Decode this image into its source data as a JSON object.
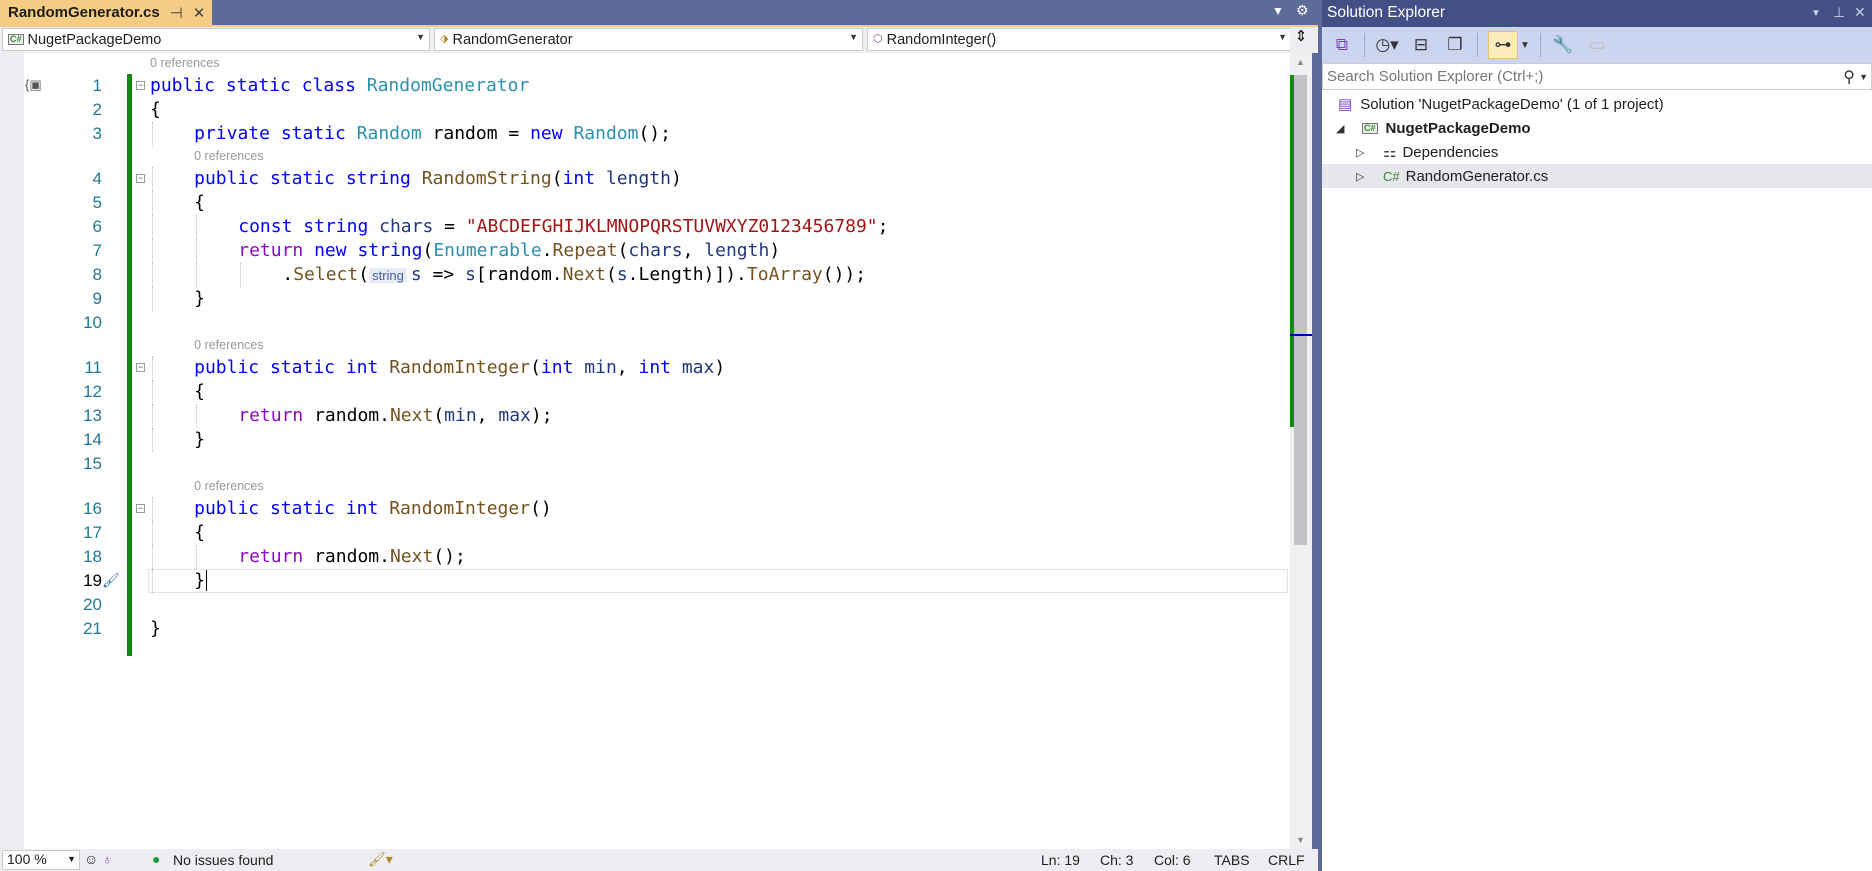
{
  "tab": {
    "title": "RandomGenerator.cs",
    "pin": "⊣",
    "close": "✕"
  },
  "nav": {
    "project": "NugetPackageDemo",
    "class": "RandomGenerator",
    "member": "RandomInteger()"
  },
  "code_rows": [
    {
      "kind": "lens",
      "text": "0 references"
    },
    {
      "kind": "code",
      "num": "1",
      "fold": true,
      "indent": 0,
      "tokens": [
        [
          "kw",
          "public "
        ],
        [
          "kw",
          "static "
        ],
        [
          "kw",
          "class "
        ],
        [
          "ty",
          "RandomGenerator"
        ]
      ]
    },
    {
      "kind": "code",
      "num": "2",
      "indent": 0,
      "tokens": [
        [
          "tx",
          "{"
        ]
      ]
    },
    {
      "kind": "code",
      "num": "3",
      "indent": 1,
      "tokens": [
        [
          "kw",
          "private "
        ],
        [
          "kw",
          "static "
        ],
        [
          "ty",
          "Random "
        ],
        [
          "tx",
          "random = "
        ],
        [
          "kw",
          "new "
        ],
        [
          "ty",
          "Random"
        ],
        [
          "tx",
          "();"
        ]
      ]
    },
    {
      "kind": "lens",
      "text": "0 references"
    },
    {
      "kind": "code",
      "num": "4",
      "fold": true,
      "indent": 1,
      "tokens": [
        [
          "kw",
          "public "
        ],
        [
          "kw",
          "static "
        ],
        [
          "kw",
          "string "
        ],
        [
          "me",
          "RandomString"
        ],
        [
          "tx",
          "("
        ],
        [
          "kw",
          "int "
        ],
        [
          "pa",
          "length"
        ],
        [
          "tx",
          ")"
        ]
      ]
    },
    {
      "kind": "code",
      "num": "5",
      "indent": 1,
      "tokens": [
        [
          "tx",
          "{"
        ]
      ]
    },
    {
      "kind": "code",
      "num": "6",
      "indent": 2,
      "tokens": [
        [
          "kw",
          "const "
        ],
        [
          "kw",
          "string "
        ],
        [
          "pa",
          "chars"
        ],
        [
          "tx",
          " = "
        ],
        [
          "st",
          "\"ABCDEFGHIJKLMNOPQRSTUVWXYZ0123456789\""
        ],
        [
          "tx",
          ";"
        ]
      ]
    },
    {
      "kind": "code",
      "num": "7",
      "indent": 2,
      "tokens": [
        [
          "ct",
          "return "
        ],
        [
          "kw",
          "new "
        ],
        [
          "kw",
          "string"
        ],
        [
          "tx",
          "("
        ],
        [
          "ty",
          "Enumerable"
        ],
        [
          "tx",
          "."
        ],
        [
          "me",
          "Repeat"
        ],
        [
          "tx",
          "("
        ],
        [
          "pa",
          "chars"
        ],
        [
          "tx",
          ", "
        ],
        [
          "pa",
          "length"
        ],
        [
          "tx",
          ")"
        ]
      ]
    },
    {
      "kind": "code",
      "num": "8",
      "indent": 3,
      "tokens": [
        [
          "tx",
          "."
        ],
        [
          "me",
          "Select"
        ],
        [
          "tx",
          "("
        ],
        [
          "hint",
          "string"
        ],
        [
          "pa",
          "s"
        ],
        [
          "tx",
          " => "
        ],
        [
          "pa",
          "s"
        ],
        [
          "tx",
          "["
        ],
        [
          "tx",
          "random."
        ],
        [
          "me",
          "Next"
        ],
        [
          "tx",
          "("
        ],
        [
          "pa",
          "s"
        ],
        [
          "tx",
          ".Length)])."
        ],
        [
          "me",
          "ToArray"
        ],
        [
          "tx",
          "());"
        ]
      ]
    },
    {
      "kind": "code",
      "num": "9",
      "indent": 1,
      "tokens": [
        [
          "tx",
          "}"
        ]
      ]
    },
    {
      "kind": "code",
      "num": "10",
      "indent": 0,
      "tokens": []
    },
    {
      "kind": "lens",
      "text": "0 references"
    },
    {
      "kind": "code",
      "num": "11",
      "fold": true,
      "indent": 1,
      "tokens": [
        [
          "kw",
          "public "
        ],
        [
          "kw",
          "static "
        ],
        [
          "kw",
          "int "
        ],
        [
          "me",
          "RandomInteger"
        ],
        [
          "tx",
          "("
        ],
        [
          "kw",
          "int "
        ],
        [
          "pa",
          "min"
        ],
        [
          "tx",
          ", "
        ],
        [
          "kw",
          "int "
        ],
        [
          "pa",
          "max"
        ],
        [
          "tx",
          ")"
        ]
      ]
    },
    {
      "kind": "code",
      "num": "12",
      "indent": 1,
      "tokens": [
        [
          "tx",
          "{"
        ]
      ]
    },
    {
      "kind": "code",
      "num": "13",
      "indent": 2,
      "tokens": [
        [
          "ct",
          "return "
        ],
        [
          "tx",
          "random."
        ],
        [
          "me",
          "Next"
        ],
        [
          "tx",
          "("
        ],
        [
          "pa",
          "min"
        ],
        [
          "tx",
          ", "
        ],
        [
          "pa",
          "max"
        ],
        [
          "tx",
          ");"
        ]
      ]
    },
    {
      "kind": "code",
      "num": "14",
      "indent": 1,
      "tokens": [
        [
          "tx",
          "}"
        ]
      ]
    },
    {
      "kind": "code",
      "num": "15",
      "indent": 0,
      "tokens": []
    },
    {
      "kind": "lens",
      "text": "0 references"
    },
    {
      "kind": "code",
      "num": "16",
      "fold": true,
      "indent": 1,
      "tokens": [
        [
          "kw",
          "public "
        ],
        [
          "kw",
          "static "
        ],
        [
          "kw",
          "int "
        ],
        [
          "me",
          "RandomInteger"
        ],
        [
          "tx",
          "()"
        ]
      ]
    },
    {
      "kind": "code",
      "num": "17",
      "indent": 1,
      "tokens": [
        [
          "tx",
          "{"
        ]
      ]
    },
    {
      "kind": "code",
      "num": "18",
      "indent": 2,
      "tokens": [
        [
          "ct",
          "return "
        ],
        [
          "tx",
          "random."
        ],
        [
          "me",
          "Next"
        ],
        [
          "tx",
          "();"
        ]
      ]
    },
    {
      "kind": "code",
      "num": "19",
      "indent": 1,
      "current": true,
      "tokens": [
        [
          "tx",
          "}"
        ]
      ]
    },
    {
      "kind": "code",
      "num": "20",
      "indent": 0,
      "tokens": []
    },
    {
      "kind": "code",
      "num": "21",
      "indent": 0,
      "tokens": [
        [
          "tx",
          "}"
        ]
      ]
    }
  ],
  "status": {
    "zoom": "100 %",
    "issues": "No issues found",
    "ln": "Ln: 19",
    "ch": "Ch: 3",
    "col": "Col: 6",
    "tabs": "TABS",
    "eol": "CRLF"
  },
  "solution_explorer": {
    "title": "Solution Explorer",
    "search_placeholder": "Search Solution Explorer (Ctrl+;)",
    "solution": "Solution 'NugetPackageDemo' (1 of 1 project)",
    "project": "NugetPackageDemo",
    "dependencies": "Dependencies",
    "file": "RandomGenerator.cs"
  }
}
